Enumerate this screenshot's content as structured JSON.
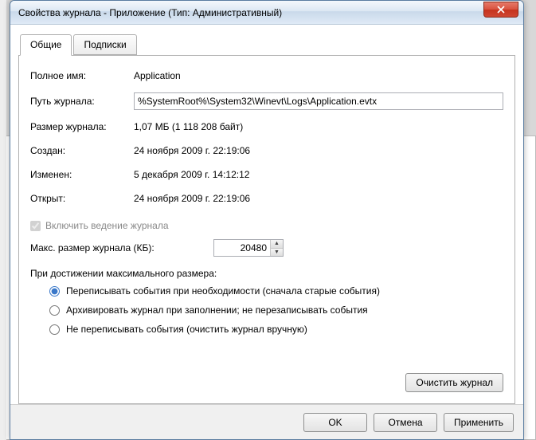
{
  "window": {
    "title": "Свойства журнала - Приложение (Тип: Административный)"
  },
  "tabs": {
    "general": "Общие",
    "subs": "Подписки"
  },
  "fields": {
    "full_name_label": "Полное имя:",
    "full_name_value": "Application",
    "path_label": "Путь журнала:",
    "path_value": "%SystemRoot%\\System32\\Winevt\\Logs\\Application.evtx",
    "size_label": "Размер журнала:",
    "size_value": "1,07 МБ (1 118 208 байт)",
    "created_label": "Создан:",
    "created_value": "24 ноября 2009 г. 22:19:06",
    "modified_label": "Изменен:",
    "modified_value": "5 декабря 2009 г. 14:12:12",
    "opened_label": "Открыт:",
    "opened_value": "24 ноября 2009 г. 22:19:06"
  },
  "logging": {
    "enable_label": "Включить ведение журнала",
    "maxsize_label": "Макс. размер журнала (КБ):",
    "maxsize_value": "20480",
    "when_max_label": "При достижении максимального размера:",
    "opt_overwrite": "Переписывать события при необходимости (сначала старые события)",
    "opt_archive": "Архивировать журнал при заполнении; не перезаписывать события",
    "opt_none": "Не переписывать события (очистить журнал вручную)"
  },
  "buttons": {
    "clear": "Очистить журнал",
    "ok": "OK",
    "cancel": "Отмена",
    "apply": "Применить"
  }
}
